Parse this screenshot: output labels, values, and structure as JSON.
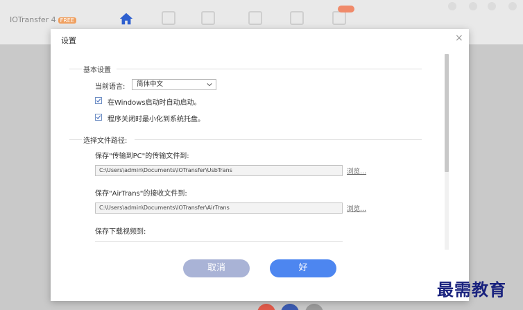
{
  "app": {
    "logo_text": "IOTransfer 4",
    "logo_badge": "FREE"
  },
  "dialog": {
    "title": "设置",
    "close_glyph": "×"
  },
  "basic": {
    "section_label": "基本设置",
    "language_label": "当前语言:",
    "language_value": "简体中文",
    "autostart_label": "在Windows启动时自动启动。",
    "autostart_checked": true,
    "minimize_label": "程序关闭时最小化到系统托盘。",
    "minimize_checked": true
  },
  "paths": {
    "section_label": "选择文件路径:",
    "items": [
      {
        "label": "保存\"传输到PC\"的传输文件到:",
        "value": "C:\\Users\\admin\\Documents\\IOTransfer\\UsbTrans",
        "browse": "浏览..."
      },
      {
        "label": "保存\"AirTrans\"的接收文件到:",
        "value": "C:\\Users\\admin\\Documents\\IOTransfer\\AirTrans",
        "browse": "浏览..."
      }
    ],
    "video_label": "保存下载视频到:"
  },
  "buttons": {
    "cancel": "取消",
    "ok": "好"
  },
  "watermark": "最需教育",
  "colors": {
    "accent": "#4d86f0",
    "cancel": "#a9b3d6",
    "checkbox": "#6f8fc4",
    "home_icon": "#2d5fcf",
    "watermark": "#1a237e"
  }
}
